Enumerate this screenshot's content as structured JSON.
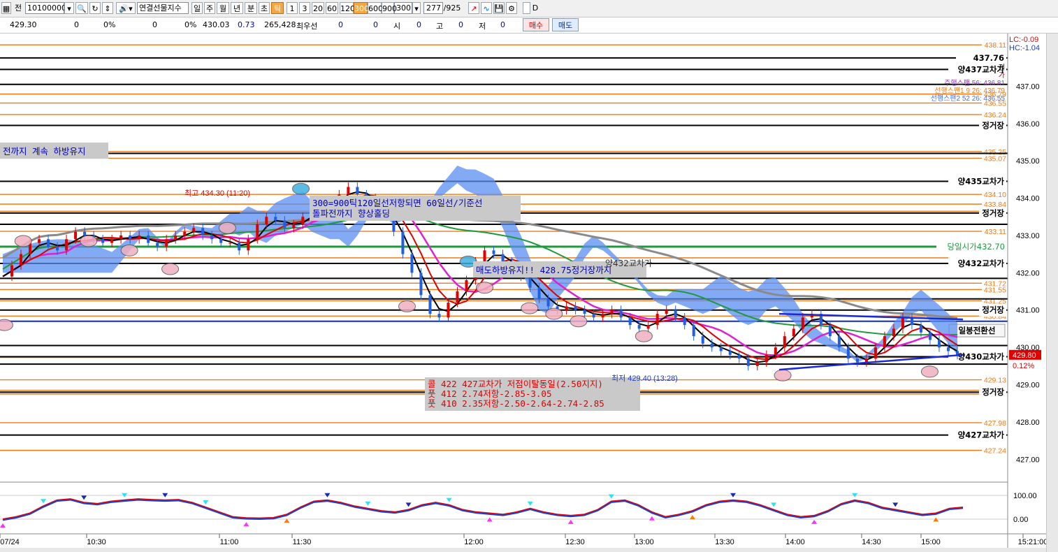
{
  "toolbar": {
    "code_prefix": "전",
    "code_value": "10100000",
    "instrument": "연결선물지수",
    "periods": [
      "일",
      "주",
      "월",
      "년",
      "분",
      "초",
      "틱"
    ],
    "period_selected": "틱",
    "intervals": [
      "1",
      "3",
      "20",
      "60",
      "120",
      "300",
      "600",
      "900"
    ],
    "interval_selected": "300",
    "interval_value": "300",
    "count_value": "277",
    "count_total": "/925",
    "checkbox_label": "D"
  },
  "infobar": {
    "price": "429.30",
    "v1": "0",
    "v2": "0%",
    "v3": "0",
    "v4": "0%",
    "v5": "430.03",
    "v6": "0.73",
    "volume": "265,428",
    "label_priority": "최우선",
    "p1": "0",
    "p2": "0",
    "label_open": "시",
    "open": "0",
    "label_high": "고",
    "high": "0",
    "label_low": "저",
    "low": "0",
    "buy_label": "매수",
    "sell_label": "매도"
  },
  "chart_data": {
    "type": "candlestick",
    "symbol": "연결선물지수",
    "ylim": [
      426.5,
      438.3
    ],
    "x_ticks": [
      "07/24",
      "10:30",
      "11:00",
      "11:30",
      "12:00",
      "12:30",
      "13:00",
      "13:30",
      "14:00",
      "14:30",
      "15:00",
      "15:21:00"
    ],
    "y_ticks": [
      437.0,
      436.0,
      435.0,
      434.0,
      433.0,
      432.0,
      431.0,
      430.0,
      429.0,
      428.0,
      427.0
    ],
    "lc_label": "LC:-0.09",
    "hc_label": "HC:-1.04",
    "current_price": "429.80",
    "current_change": "0.12%",
    "orange_levels": [
      {
        "y": 438.11,
        "label": "438.11"
      },
      {
        "y": 436.79,
        "label": "436.79"
      },
      {
        "y": 436.55,
        "label": "436.55"
      },
      {
        "y": 436.24,
        "label": "436.24"
      },
      {
        "y": 435.25,
        "label": "435.25"
      },
      {
        "y": 435.07,
        "label": "435.07"
      },
      {
        "y": 434.1,
        "label": "434.10"
      },
      {
        "y": 433.84,
        "label": "433.84"
      },
      {
        "y": 433.65,
        "label": ""
      },
      {
        "y": 433.11,
        "label": "433.11"
      },
      {
        "y": 432.4,
        "label": ""
      },
      {
        "y": 431.72,
        "label": "431.72"
      },
      {
        "y": 431.55,
        "label": "431.55"
      },
      {
        "y": 431.25,
        "label": "431.25"
      },
      {
        "y": 430.84,
        "label": "430.84"
      },
      {
        "y": 429.73,
        "label": "429.73"
      },
      {
        "y": 429.13,
        "label": "429.13"
      },
      {
        "y": 428.85,
        "label": "428.85"
      },
      {
        "y": 428.75,
        "label": "428.75"
      },
      {
        "y": 427.98,
        "label": "427.98"
      },
      {
        "y": 427.24,
        "label": "427.24"
      }
    ],
    "black_levels": [
      {
        "y": 437.76,
        "label": "437.76"
      },
      {
        "y": 437.45,
        "label": "양437교차가"
      },
      {
        "y": 437.05,
        "label": ""
      },
      {
        "y": 435.95,
        "label": "정거장"
      },
      {
        "y": 435.2,
        "label": ""
      },
      {
        "y": 434.45,
        "label": "양435교차가"
      },
      {
        "y": 433.6,
        "label": "정거장"
      },
      {
        "y": 433.3,
        "label": ""
      },
      {
        "y": 432.25,
        "label": "양432교차가"
      },
      {
        "y": 431.85,
        "label": ""
      },
      {
        "y": 431.3,
        "label": ""
      },
      {
        "y": 431.0,
        "label": "정거장"
      },
      {
        "y": 430.05,
        "label": ""
      },
      {
        "y": 429.75,
        "label": "양430교차가"
      },
      {
        "y": 429.55,
        "label": ""
      },
      {
        "y": 428.8,
        "label": "정거장"
      },
      {
        "y": 427.65,
        "label": "양427교차가"
      }
    ],
    "green_level": {
      "y": 432.7,
      "label": "당일시가432.70"
    },
    "blue_level": {
      "y": 430.7,
      "label": ""
    },
    "right_labels": [
      {
        "y": 430.45,
        "text": "일봉전환선"
      }
    ],
    "top_right_notes": [
      "전",
      "가",
      "주행스팬 56: 436.81",
      "선행스팬1 9 26: 436.79",
      "선행스팬2 52 26: 436.55"
    ],
    "annotations": [
      {
        "text": "전까지 계속 하방유지"
      },
      {
        "text": "300=900틱120일선저항되면 60일선/기준선"
      },
      {
        "text": "돌파전까지 향상홀딩"
      },
      {
        "text": "매도하방유지!! 428.75정거장까지"
      },
      {
        "text": "콜 422 427교차가 저점이탈동일(2.50지지)"
      },
      {
        "text": "풋 412 2.74저항-2.85-3.05"
      },
      {
        "text": "풋 410 2.35저항-2.50-2.64-2.74-2.85"
      }
    ],
    "high_label": "최고 434.30 (11:20)",
    "low_label": "최저 429.40 (13:28)",
    "hidden_label": "양432교차가",
    "close_series": [
      431.9,
      432.2,
      432.5,
      432.8,
      432.9,
      432.7,
      432.6,
      432.9,
      433.1,
      433.0,
      432.9,
      432.8,
      432.9,
      433.0,
      432.9,
      433.0,
      432.8,
      432.7,
      432.9,
      433.0,
      433.1,
      433.2,
      433.0,
      432.9,
      432.8,
      432.8,
      432.6,
      432.9,
      433.3,
      433.5,
      433.4,
      433.2,
      433.3,
      433.5,
      433.7,
      433.6,
      433.9,
      434.1,
      434.3,
      434.1,
      434.0,
      433.8,
      433.6,
      433.1,
      432.5,
      432.0,
      431.4,
      430.9,
      430.8,
      431.2,
      431.5,
      431.8,
      432.3,
      432.6,
      432.5,
      432.3,
      432.1,
      431.9,
      431.6,
      431.3,
      431.1,
      431.0,
      431.1,
      431.0,
      430.9,
      430.8,
      430.9,
      431.0,
      430.8,
      430.6,
      430.5,
      430.6,
      430.9,
      431.0,
      430.8,
      430.6,
      430.3,
      430.1,
      430.0,
      429.9,
      429.8,
      429.7,
      429.5,
      429.6,
      429.8,
      430.0,
      430.3,
      430.5,
      430.8,
      430.9,
      430.6,
      430.3,
      430.0,
      429.7,
      429.6,
      429.7,
      430.0,
      430.3,
      430.5,
      430.8,
      430.6,
      430.4,
      430.2,
      430.0,
      429.9,
      429.8
    ],
    "oscillator": {
      "ylim": [
        -50,
        150
      ],
      "y_ticks": [
        100.0,
        0.0
      ],
      "series": [
        0,
        10,
        25,
        55,
        80,
        85,
        70,
        65,
        75,
        80,
        85,
        82,
        80,
        82,
        70,
        50,
        30,
        10,
        5,
        4,
        6,
        20,
        50,
        75,
        80,
        70,
        55,
        45,
        35,
        30,
        40,
        60,
        70,
        60,
        40,
        30,
        25,
        20,
        30,
        45,
        30,
        20,
        15,
        20,
        40,
        75,
        80,
        60,
        30,
        10,
        20,
        35,
        60,
        75,
        80,
        75,
        60,
        40,
        20,
        10,
        15,
        35,
        65,
        80,
        70,
        50,
        40,
        30,
        20,
        25,
        45,
        50
      ]
    }
  }
}
